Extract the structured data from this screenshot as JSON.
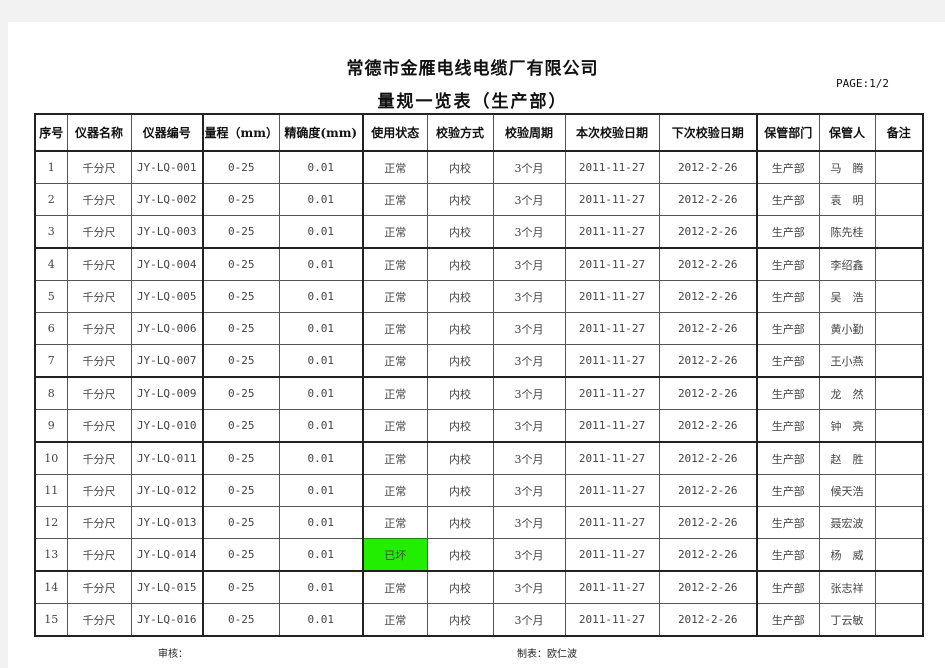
{
  "document": {
    "company_title": "常德市金雁电线电缆厂有限公司",
    "subtitle": "量规一览表（生产部）",
    "page_indicator": "PAGE:1/2"
  },
  "table": {
    "headers": [
      "序号",
      "仪器名称",
      "仪器编号",
      "量程（mm）",
      "精确度(mm)",
      "使用状态",
      "校验方式",
      "校验周期",
      "本次校验日期",
      "下次校验日期",
      "保管部门",
      "保管人",
      "备注"
    ],
    "rows": [
      {
        "no": "1",
        "name": "千分尺",
        "code": "JY-LQ-001",
        "range": "0-25",
        "precision": "0.01",
        "status": "正常",
        "method": "内校",
        "cycle": "3个月",
        "this_date": "2011-11-27",
        "next_date": "2012-2-26",
        "dept": "生产部",
        "keeper": "马　腾",
        "remark": ""
      },
      {
        "no": "2",
        "name": "千分尺",
        "code": "JY-LQ-002",
        "range": "0-25",
        "precision": "0.01",
        "status": "正常",
        "method": "内校",
        "cycle": "3个月",
        "this_date": "2011-11-27",
        "next_date": "2012-2-26",
        "dept": "生产部",
        "keeper": "袁　明",
        "remark": ""
      },
      {
        "no": "3",
        "name": "千分尺",
        "code": "JY-LQ-003",
        "range": "0-25",
        "precision": "0.01",
        "status": "正常",
        "method": "内校",
        "cycle": "3个月",
        "this_date": "2011-11-27",
        "next_date": "2012-2-26",
        "dept": "生产部",
        "keeper": "陈先桂",
        "remark": ""
      },
      {
        "no": "4",
        "name": "千分尺",
        "code": "JY-LQ-004",
        "range": "0-25",
        "precision": "0.01",
        "status": "正常",
        "method": "内校",
        "cycle": "3个月",
        "this_date": "2011-11-27",
        "next_date": "2012-2-26",
        "dept": "生产部",
        "keeper": "李绍鑫",
        "remark": ""
      },
      {
        "no": "5",
        "name": "千分尺",
        "code": "JY-LQ-005",
        "range": "0-25",
        "precision": "0.01",
        "status": "正常",
        "method": "内校",
        "cycle": "3个月",
        "this_date": "2011-11-27",
        "next_date": "2012-2-26",
        "dept": "生产部",
        "keeper": "吴　浩",
        "remark": ""
      },
      {
        "no": "6",
        "name": "千分尺",
        "code": "JY-LQ-006",
        "range": "0-25",
        "precision": "0.01",
        "status": "正常",
        "method": "内校",
        "cycle": "3个月",
        "this_date": "2011-11-27",
        "next_date": "2012-2-26",
        "dept": "生产部",
        "keeper": "黄小勤",
        "remark": ""
      },
      {
        "no": "7",
        "name": "千分尺",
        "code": "JY-LQ-007",
        "range": "0-25",
        "precision": "0.01",
        "status": "正常",
        "method": "内校",
        "cycle": "3个月",
        "this_date": "2011-11-27",
        "next_date": "2012-2-26",
        "dept": "生产部",
        "keeper": "王小燕",
        "remark": ""
      },
      {
        "no": "8",
        "name": "千分尺",
        "code": "JY-LQ-009",
        "range": "0-25",
        "precision": "0.01",
        "status": "正常",
        "method": "内校",
        "cycle": "3个月",
        "this_date": "2011-11-27",
        "next_date": "2012-2-26",
        "dept": "生产部",
        "keeper": "龙　然",
        "remark": ""
      },
      {
        "no": "9",
        "name": "千分尺",
        "code": "JY-LQ-010",
        "range": "0-25",
        "precision": "0.01",
        "status": "正常",
        "method": "内校",
        "cycle": "3个月",
        "this_date": "2011-11-27",
        "next_date": "2012-2-26",
        "dept": "生产部",
        "keeper": "钟　亮",
        "remark": ""
      },
      {
        "no": "10",
        "name": "千分尺",
        "code": "JY-LQ-011",
        "range": "0-25",
        "precision": "0.01",
        "status": "正常",
        "method": "内校",
        "cycle": "3个月",
        "this_date": "2011-11-27",
        "next_date": "2012-2-26",
        "dept": "生产部",
        "keeper": "赵　胜",
        "remark": ""
      },
      {
        "no": "11",
        "name": "千分尺",
        "code": "JY-LQ-012",
        "range": "0-25",
        "precision": "0.01",
        "status": "正常",
        "method": "内校",
        "cycle": "3个月",
        "this_date": "2011-11-27",
        "next_date": "2012-2-26",
        "dept": "生产部",
        "keeper": "候天浩",
        "remark": ""
      },
      {
        "no": "12",
        "name": "千分尺",
        "code": "JY-LQ-013",
        "range": "0-25",
        "precision": "0.01",
        "status": "正常",
        "method": "内校",
        "cycle": "3个月",
        "this_date": "2011-11-27",
        "next_date": "2012-2-26",
        "dept": "生产部",
        "keeper": "聂宏波",
        "remark": ""
      },
      {
        "no": "13",
        "name": "千分尺",
        "code": "JY-LQ-014",
        "range": "0-25",
        "precision": "0.01",
        "status": "已坏",
        "method": "内校",
        "cycle": "3个月",
        "this_date": "2011-11-27",
        "next_date": "2012-2-26",
        "dept": "生产部",
        "keeper": "杨　威",
        "remark": ""
      },
      {
        "no": "14",
        "name": "千分尺",
        "code": "JY-LQ-015",
        "range": "0-25",
        "precision": "0.01",
        "status": "正常",
        "method": "内校",
        "cycle": "3个月",
        "this_date": "2011-11-27",
        "next_date": "2012-2-26",
        "dept": "生产部",
        "keeper": "张志祥",
        "remark": ""
      },
      {
        "no": "15",
        "name": "千分尺",
        "code": "JY-LQ-016",
        "range": "0-25",
        "precision": "0.01",
        "status": "正常",
        "method": "内校",
        "cycle": "3个月",
        "this_date": "2011-11-27",
        "next_date": "2012-2-26",
        "dept": "生产部",
        "keeper": "丁云敏",
        "remark": ""
      }
    ],
    "broken_status_color": "#22ee00"
  },
  "footer": {
    "reviewer_label": "审核：",
    "preparer_label": "制表：欧仁波"
  }
}
